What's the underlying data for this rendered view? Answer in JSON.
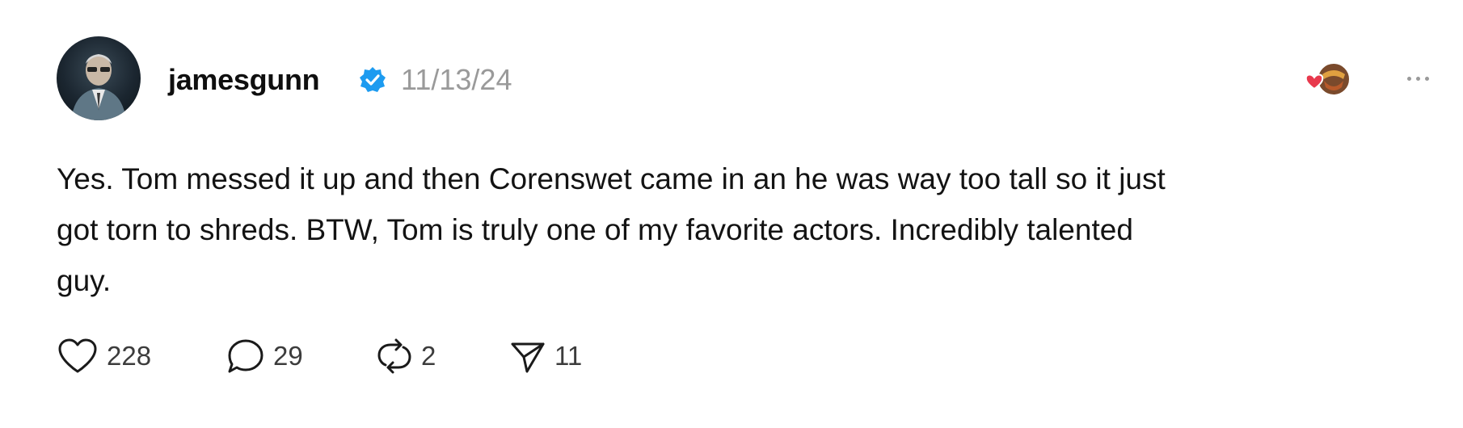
{
  "post": {
    "username": "jamesgunn",
    "verified": true,
    "timestamp": "11/13/24",
    "text": "Yes. Tom messed it up and then Corenswet came in an he was way too tall so it just\ngot torn to shreds. BTW, Tom is truly one of my favorite actors. Incredibly talented\nguy.",
    "avatar_icon": "profile-photo",
    "reaction_icon": "heart-and-avatar-reaction-icon",
    "more_icon": "ellipsis-icon"
  },
  "actions": {
    "like": {
      "icon": "heart-icon",
      "count": "228"
    },
    "reply": {
      "icon": "comment-icon",
      "count": "29"
    },
    "repost": {
      "icon": "repost-icon",
      "count": "2"
    },
    "share": {
      "icon": "send-icon",
      "count": "11"
    }
  },
  "colors": {
    "text": "#131313",
    "muted": "#9a9a9a",
    "verified_blue": "#1d9bf0",
    "heart_red": "#e8394d"
  }
}
